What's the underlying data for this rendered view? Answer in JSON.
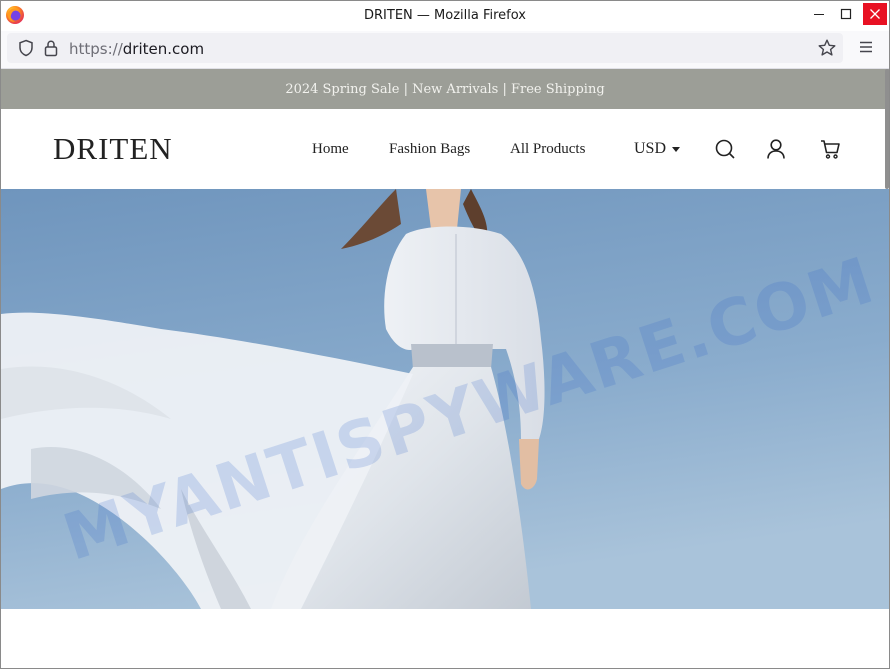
{
  "browser": {
    "window_title": "DRITEN — Mozilla Firefox",
    "url_scheme": "https://",
    "url_host": "driten.com"
  },
  "store": {
    "announcement": "2024 Spring Sale | New Arrivals | Free Shipping",
    "brand": "DRITEN",
    "nav": [
      {
        "label": "Home"
      },
      {
        "label": "Fashion Bags"
      },
      {
        "label": "All Products"
      }
    ],
    "currency": "USD",
    "icons": [
      "search-icon",
      "account-icon",
      "cart-icon"
    ]
  },
  "hero": {
    "watermark": "MYANTISPYWARE.COM"
  },
  "colors": {
    "announcement_bg": "#9c9e97",
    "sky_top": "#6f95bd",
    "sky_bottom": "#a9c3da",
    "close_button": "#e81123"
  }
}
